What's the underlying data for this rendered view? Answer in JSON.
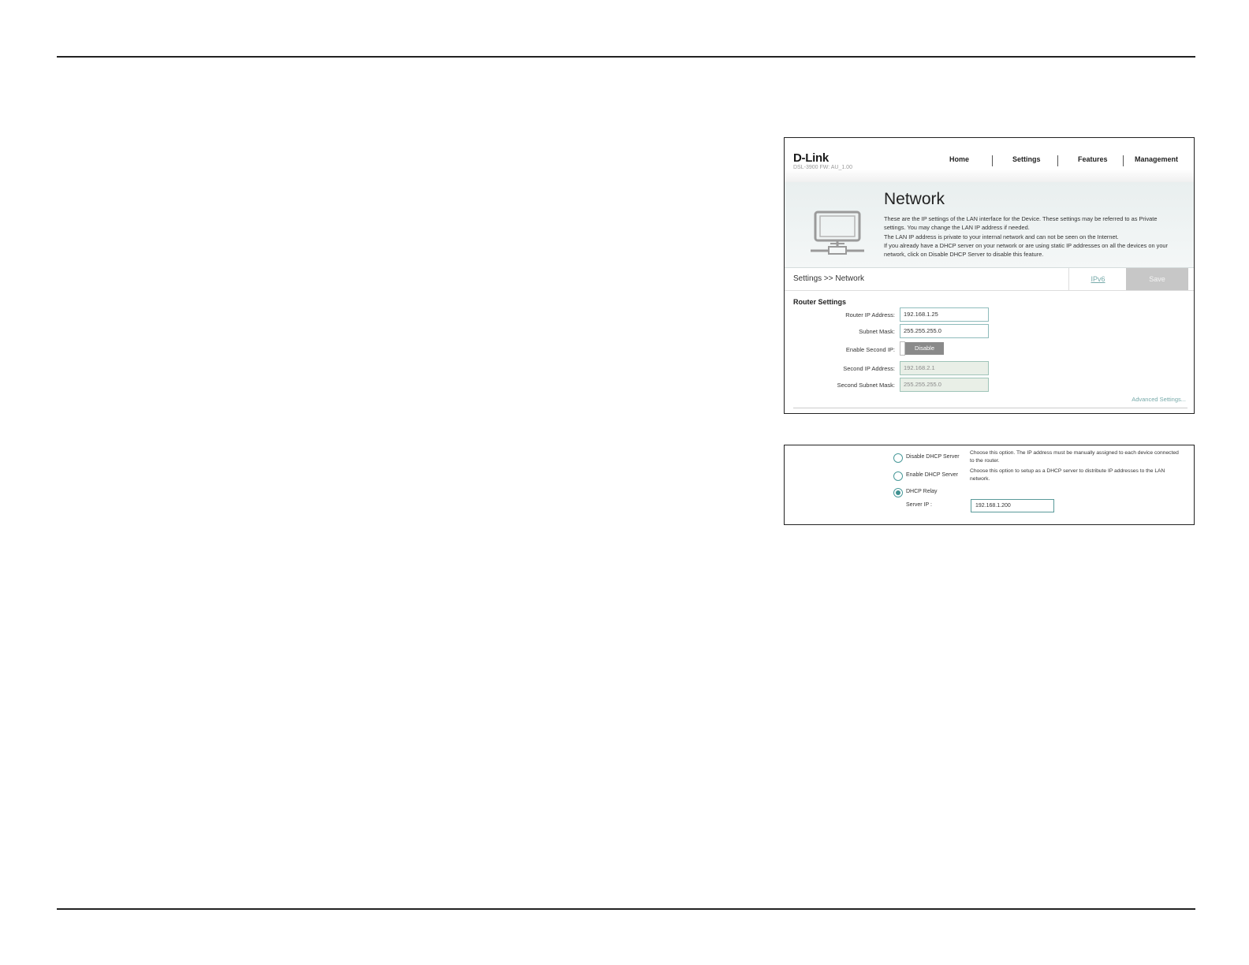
{
  "router_ui": {
    "logo": "D-Link",
    "logo_sub": "DSL-3900  FW: AU_1.00",
    "nav": [
      "Home",
      "Settings",
      "Features",
      "Management"
    ],
    "title": "Network",
    "description": [
      "These are the IP settings of the LAN interface for the Device. These settings may be referred to as Private",
      "settings. You may change the LAN IP address if needed.",
      "The LAN IP address is private to your internal network and can not be seen on the Internet.",
      "If you already have a DHCP server on your network or are using static IP addresses on all the devices on your",
      "network, click on Disable DHCP Server to disable this feature."
    ],
    "breadcrumb": "Settings >> Network",
    "ipv6_link": "IPv6",
    "save_label": "Save",
    "section_title": "Router Settings",
    "fields": {
      "router_ip_label": "Router IP Address:",
      "router_ip_value": "192.168.1.25",
      "subnet_label": "Subnet Mask:",
      "subnet_value": "255.255.255.0",
      "second_ip_toggle_label": "Enable Second IP:",
      "second_ip_toggle_state": "Disable",
      "second_ip_label": "Second IP Address:",
      "second_ip_value": "192.168.2.1",
      "second_subnet_label": "Second Subnet Mask:",
      "second_subnet_value": "255.255.255.0"
    },
    "advanced_link": "Advanced Settings..."
  },
  "dhcp_ui": {
    "options": [
      {
        "label": "Disable DHCP Server",
        "description": "Choose this option. The IP address must be manually assigned to each device connected to the router.",
        "selected": false
      },
      {
        "label": "Enable DHCP Server",
        "description": "Choose this option to setup as a DHCP server to distribute IP addresses to the LAN network.",
        "selected": false
      },
      {
        "label": "DHCP Relay",
        "description": "",
        "selected": true
      }
    ],
    "server_ip_label": "Server IP :",
    "server_ip_value": "192.168.1.200"
  },
  "colors": {
    "accent": "#4a9a9a",
    "save_disabled": "#c7c7c7",
    "toggle": "#8a8a8a"
  }
}
